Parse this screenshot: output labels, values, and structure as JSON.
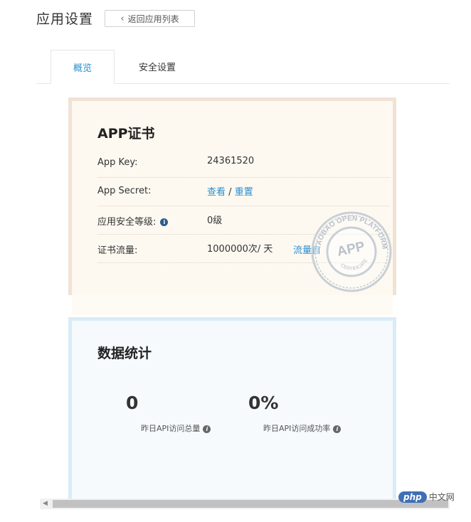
{
  "header": {
    "title": "应用设置",
    "back_label": "返回应用列表"
  },
  "tabs": [
    {
      "label": "概览",
      "active": true
    },
    {
      "label": "安全设置",
      "active": false
    }
  ],
  "certificate": {
    "title": "APP证书",
    "rows": {
      "app_key": {
        "label": "App Key:",
        "value": "24361520"
      },
      "app_secret": {
        "label": "App Secret:",
        "view": "查看",
        "sep": "/",
        "reset": "重置"
      },
      "security_level": {
        "label": "应用安全等级:",
        "value": "0级"
      },
      "traffic": {
        "label": "证书流量:",
        "value": "1000000次/ 天",
        "link": "流量自"
      }
    },
    "stamp": {
      "top_text": "TAOBAO OPEN PLATFORM",
      "center": "APP",
      "bottom": "CERTIFICATE"
    }
  },
  "stats": {
    "title": "数据统计",
    "items": [
      {
        "value": "0",
        "label": "昨日API访问总量"
      },
      {
        "value": "0%",
        "label": "昨日API访问成功率"
      }
    ]
  },
  "watermark": {
    "pill": "php",
    "text": "中文网"
  },
  "colors": {
    "accent": "#2a8fd0",
    "cert_border": "#f2e2d6",
    "stats_border": "#d9ecf7"
  },
  "icons": {
    "back": "chevron-left-icon",
    "info": "info-icon",
    "help": "help-icon"
  }
}
